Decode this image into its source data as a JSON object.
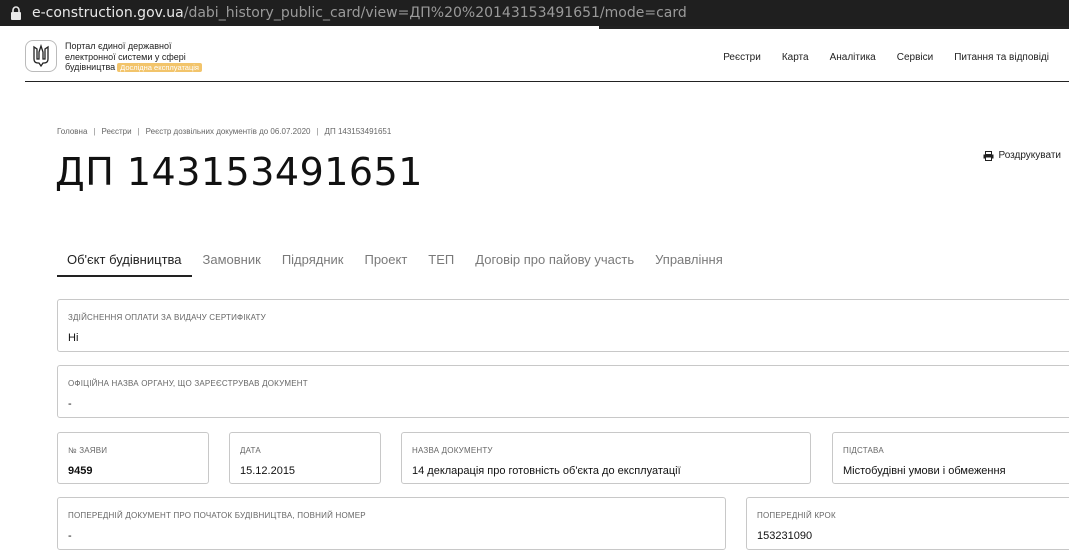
{
  "browser": {
    "url_host": "e-construction.gov.ua",
    "url_path": "/dabi_history_public_card/view=ДП%20%20143153491651/mode=card"
  },
  "header": {
    "logo_line1": "Портал єдиної державної",
    "logo_line2": "електронної системи у сфері",
    "logo_line3": "будівництва",
    "logo_badge": "Дослідна експлуатація",
    "nav": [
      "Реєстри",
      "Карта",
      "Аналітика",
      "Сервіси",
      "Питання та відповіді"
    ]
  },
  "breadcrumb": [
    "Головна",
    "Реєстри",
    "Реєстр дозвільних документів до 06.07.2020",
    "ДП 143153491651"
  ],
  "page_title": "ДП 143153491651",
  "print_label": "Роздрукувати",
  "tabs": [
    "Об'єкт будівництва",
    "Замовник",
    "Підрядник",
    "Проект",
    "ТЕП",
    "Договір про пайову участь",
    "Управління"
  ],
  "fields": {
    "payment": {
      "label": "Здійснення оплати за видачу сертифікату",
      "value": "Ні"
    },
    "authority": {
      "label": "Офіційна назва органу, що зареєстрував документ",
      "value": "-"
    },
    "application_no": {
      "label": "№ заяви",
      "value": "9459"
    },
    "date": {
      "label": "Дата",
      "value": "15.12.2015"
    },
    "doc_name": {
      "label": "Назва документу",
      "value": "14 декларація про готовність об'єкта до експлуатації"
    },
    "basis": {
      "label": "Підстава",
      "value": "Містобудівні умови і обмеження"
    },
    "prev_doc": {
      "label": "Попередній документ про початок будівництва, повний номер",
      "value": "-"
    },
    "prev_step": {
      "label": "Попередній крок",
      "value": "153231090"
    }
  }
}
